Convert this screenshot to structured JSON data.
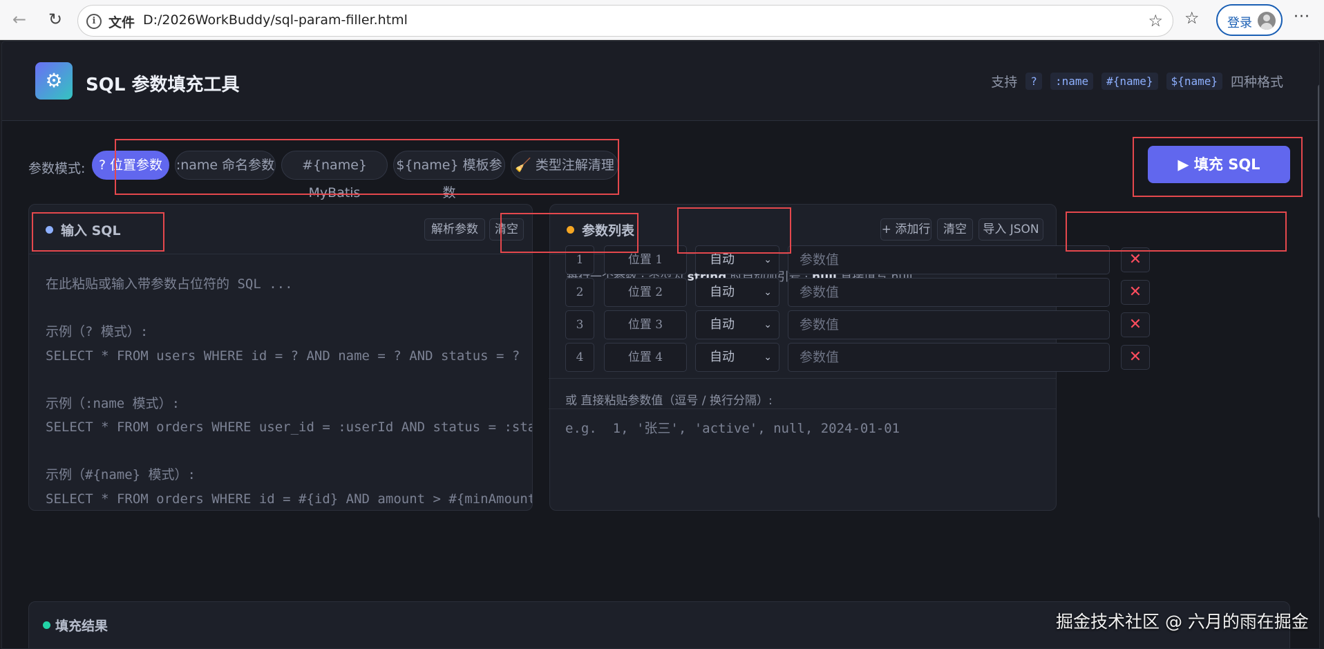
{
  "browser": {
    "addr_label": "文件",
    "url": "D:/2026WorkBuddy/sql-param-filler.html",
    "login_label": "登录"
  },
  "header": {
    "logo_icon": "⚙",
    "title": "SQL 参数填充工具",
    "support_prefix": "支持",
    "formats": [
      "?",
      ":name",
      "#{name}",
      "${name}"
    ],
    "support_suffix": "四种格式"
  },
  "modes": {
    "label": "参数模式:",
    "items": [
      "? 位置参数",
      ":name 命名参数",
      "#{name} MyBatis",
      "${name} 模板参数",
      "🧹 类型注解清理"
    ],
    "active_index": 0
  },
  "fill_button": "▶ 填充 SQL",
  "input_panel": {
    "title": "输入 SQL",
    "parse_label": "解析参数",
    "clear_label": "清空",
    "placeholder": "在此粘贴或输入带参数占位符的 SQL ...\n\n示例（? 模式）:\nSELECT * FROM users WHERE id = ? AND name = ? AND status = ?\n\n示例（:name 模式）:\nSELECT * FROM orders WHERE user_id = :userId AND status = :status\n\n示例（#{name} 模式）:\nSELECT * FROM orders WHERE id = #{id} AND amount > #{minAmount}"
  },
  "param_panel": {
    "title": "参数列表",
    "add_label": "+ 添加行",
    "clear_label": "清空",
    "import_label": "导入 JSON",
    "hint_parts": [
      "每行一个参数 · 类型为 ",
      "string",
      " 时自动加引号 · ",
      "null",
      " 直接填写 null"
    ],
    "rows": [
      {
        "index": "1",
        "name": "位置 1",
        "type": "自动",
        "placeholder": "参数值"
      },
      {
        "index": "2",
        "name": "位置 2",
        "type": "自动",
        "placeholder": "参数值"
      },
      {
        "index": "3",
        "name": "位置 3",
        "type": "自动",
        "placeholder": "参数值"
      },
      {
        "index": "4",
        "name": "位置 4",
        "type": "自动",
        "placeholder": "参数值"
      }
    ],
    "paste_label": "或 直接粘贴参数值（逗号 / 换行分隔）:",
    "paste_placeholder": "e.g.  1, '张三', 'active', null, 2024-01-01"
  },
  "result_panel": {
    "title": "填充结果"
  },
  "watermark": "掘金技术社区 @ 六月的雨在掘金",
  "colors": {
    "accent": "#6167ee",
    "input_dot": "#8eb0ff",
    "param_dot": "#f5a623",
    "result_dot": "#22d3a6",
    "annotation": "#e5484d"
  }
}
